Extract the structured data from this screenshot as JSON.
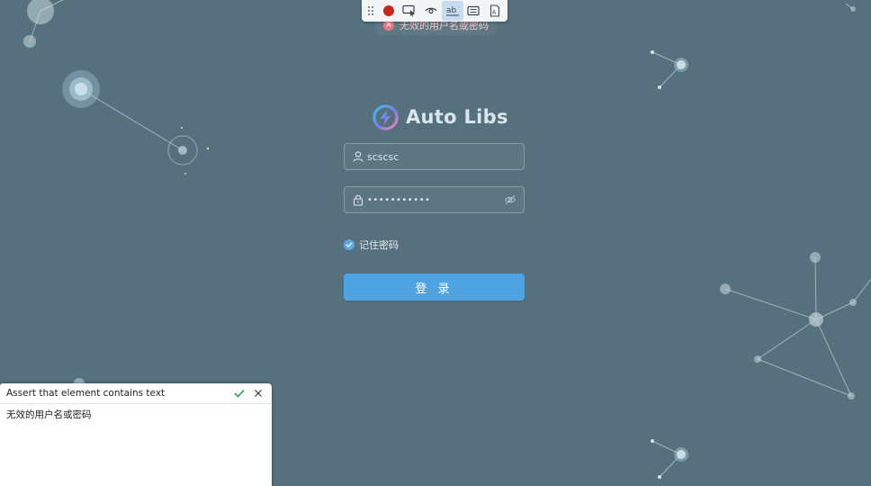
{
  "toolbar": {
    "buttons": [
      {
        "name": "drag-handle",
        "icon": "drag-dots-icon",
        "active": false
      },
      {
        "name": "record",
        "icon": "record-icon",
        "active": false
      },
      {
        "name": "pick-locator",
        "icon": "pick-element-icon",
        "active": false
      },
      {
        "name": "assert-visibility",
        "icon": "eye-icon",
        "active": false
      },
      {
        "name": "assert-text",
        "icon": "text-ab-icon",
        "active": true
      },
      {
        "name": "assert-value",
        "icon": "value-box-icon",
        "active": false
      },
      {
        "name": "assert-snapshot",
        "icon": "snapshot-doc-icon",
        "active": false
      }
    ],
    "record_color": "#c2291c"
  },
  "error_toast": {
    "message": "无效的用户名或密码"
  },
  "login": {
    "logo_text": "Auto Libs",
    "username_value": "scscsc",
    "password_value": "•••••••••••",
    "remember_label": "记住密码",
    "remember_checked": true,
    "login_button": "登 录"
  },
  "assert_panel": {
    "title": "Assert that element contains text",
    "text_value": "无效的用户名或密码"
  },
  "colors": {
    "background": "#56717d",
    "primary": "#4ea3e0",
    "error": "#e87a86"
  }
}
